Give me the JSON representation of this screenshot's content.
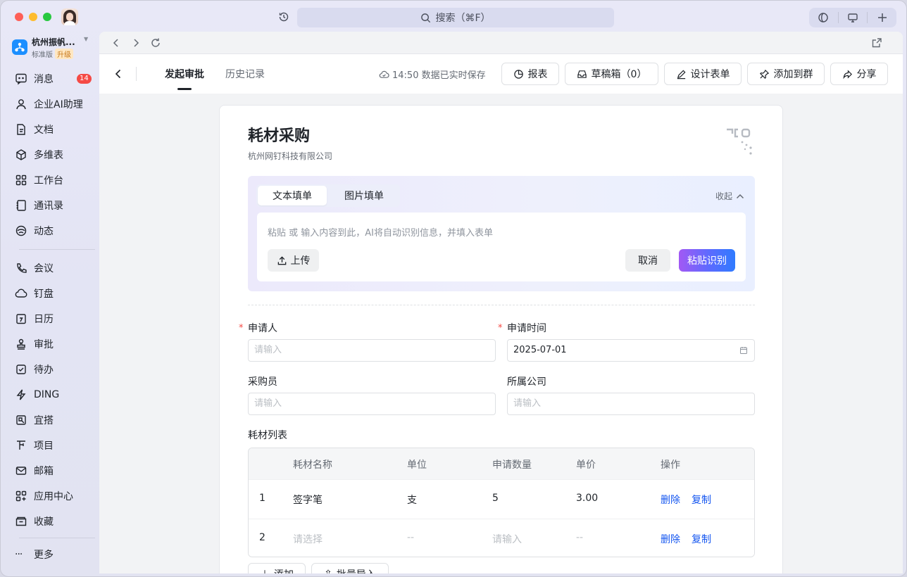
{
  "titlebar": {
    "search_label": "搜索（⌘F）"
  },
  "org": {
    "name": "杭州振帆...",
    "plan": "标准版",
    "upgrade": "升级"
  },
  "sidebar": {
    "items": [
      {
        "label": "消息",
        "icon": "message-icon",
        "badge": "14"
      },
      {
        "label": "企业AI助理",
        "icon": "ai-assistant-icon"
      },
      {
        "label": "文档",
        "icon": "document-icon"
      },
      {
        "label": "多维表",
        "icon": "multi-table-icon"
      },
      {
        "label": "工作台",
        "icon": "workbench-icon"
      },
      {
        "label": "通讯录",
        "icon": "contacts-icon"
      },
      {
        "label": "动态",
        "icon": "moments-icon"
      },
      {
        "label": "会议",
        "icon": "meeting-icon"
      },
      {
        "label": "钉盘",
        "icon": "cloud-drive-icon"
      },
      {
        "label": "日历",
        "icon": "calendar-icon"
      },
      {
        "label": "审批",
        "icon": "approval-icon"
      },
      {
        "label": "待办",
        "icon": "todo-icon"
      },
      {
        "label": "DING",
        "icon": "ding-icon"
      },
      {
        "label": "宜搭",
        "icon": "yida-icon"
      },
      {
        "label": "项目",
        "icon": "project-icon"
      },
      {
        "label": "邮箱",
        "icon": "mail-icon"
      },
      {
        "label": "应用中心",
        "icon": "app-center-icon"
      },
      {
        "label": "收藏",
        "icon": "favorites-icon"
      }
    ],
    "more": "更多"
  },
  "header": {
    "tabs": [
      {
        "label": "发起审批"
      },
      {
        "label": "历史记录"
      }
    ],
    "saved_status": "14:50 数据已实时保存",
    "buttons": {
      "report": "报表",
      "drafts": "草稿箱（0）",
      "design": "设计表单",
      "add_group": "添加到群",
      "share": "分享"
    }
  },
  "form": {
    "title": "耗材采购",
    "company": "杭州网钉科技有限公司",
    "ai": {
      "tab_text": "文本填单",
      "tab_image": "图片填单",
      "collapse": "收起",
      "placeholder": "粘贴 或 输入内容到此，AI将自动识别信息，并填入表单",
      "upload": "上传",
      "cancel": "取消",
      "recognize": "粘贴识别"
    },
    "fields": {
      "applicant_label": "申请人",
      "applicant_placeholder": "请输入",
      "apply_time_label": "申请时间",
      "apply_time_value": "2025-07-01",
      "buyer_label": "采购员",
      "buyer_placeholder": "请输入",
      "company_label": "所属公司",
      "company_placeholder": "请输入"
    },
    "table": {
      "title": "耗材列表",
      "headers": [
        "耗材名称",
        "单位",
        "申请数量",
        "单价",
        "操作"
      ],
      "rows": [
        {
          "index": "1",
          "name": "签字笔",
          "unit": "支",
          "qty": "5",
          "price": "3.00",
          "delete": "删除",
          "copy": "复制"
        },
        {
          "index": "2",
          "name": "请选择",
          "unit": "--",
          "qty": "请输入",
          "price": "--",
          "delete": "删除",
          "copy": "复制"
        }
      ]
    },
    "bottom_buttons": {
      "add": "添加",
      "batch_import": "批量导入"
    }
  },
  "colors": {
    "accent": "#1456f0",
    "required": "#f54a45",
    "badge": "#f54a45"
  }
}
